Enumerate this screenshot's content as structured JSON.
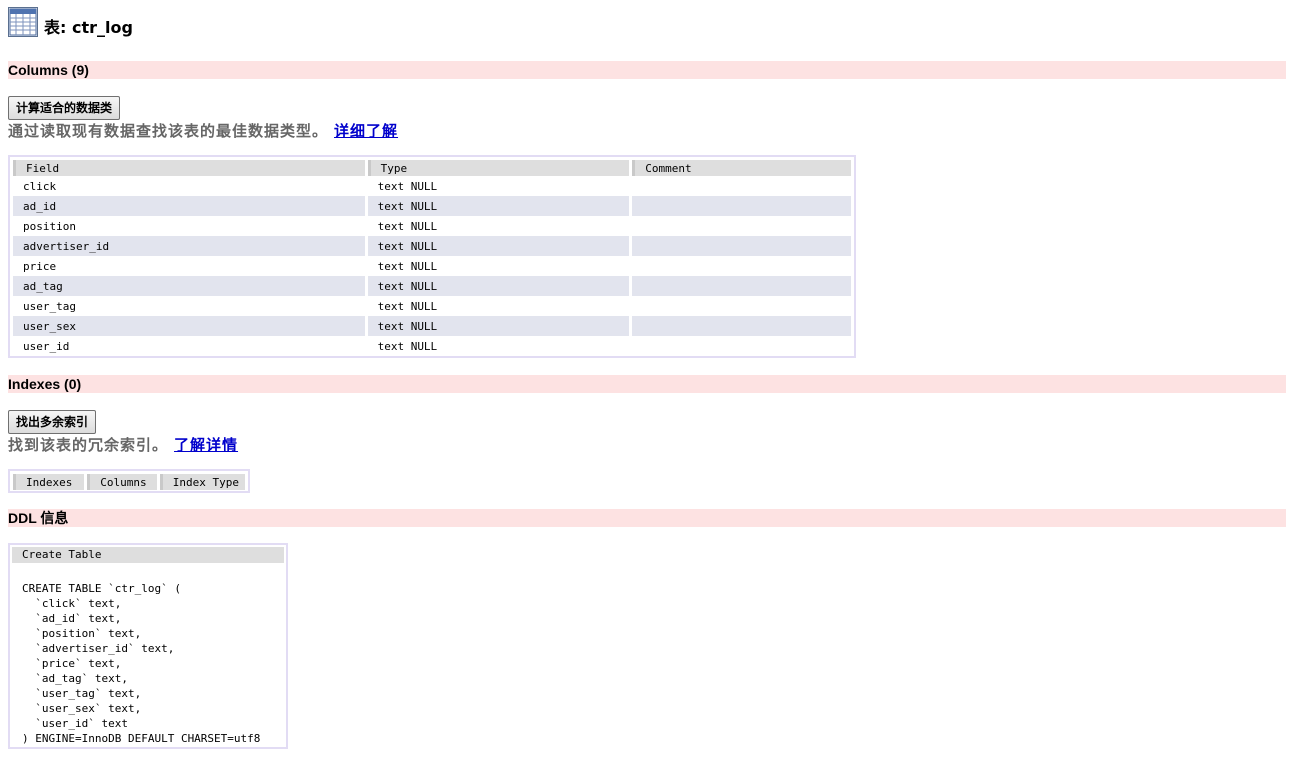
{
  "header": {
    "title": "表: ctr_log"
  },
  "columns_section": {
    "title": "Columns (9)",
    "button_label": "计算适合的数据类",
    "hint_text": "通过读取现有数据查找该表的最佳数据类型。",
    "hint_link": "详细了解",
    "headers": [
      "Field",
      "Type",
      "Comment"
    ],
    "rows": [
      {
        "field": "click",
        "type": "text NULL",
        "comment": ""
      },
      {
        "field": "ad_id",
        "type": "text NULL",
        "comment": ""
      },
      {
        "field": "position",
        "type": "text NULL",
        "comment": ""
      },
      {
        "field": "advertiser_id",
        "type": "text NULL",
        "comment": ""
      },
      {
        "field": "price",
        "type": "text NULL",
        "comment": ""
      },
      {
        "field": "ad_tag",
        "type": "text NULL",
        "comment": ""
      },
      {
        "field": "user_tag",
        "type": "text NULL",
        "comment": ""
      },
      {
        "field": "user_sex",
        "type": "text NULL",
        "comment": ""
      },
      {
        "field": "user_id",
        "type": "text NULL",
        "comment": ""
      }
    ]
  },
  "indexes_section": {
    "title": "Indexes (0)",
    "button_label": "找出多余索引",
    "hint_text": "找到该表的冗余索引。",
    "hint_link": "了解详情",
    "headers": [
      "Indexes",
      "Columns",
      "Index Type"
    ]
  },
  "ddl_section": {
    "title": "DDL 信息",
    "header": "Create Table",
    "code": "CREATE TABLE `ctr_log` (\n  `click` text,\n  `ad_id` text,\n  `position` text,\n  `advertiser_id` text,\n  `price` text,\n  `ad_tag` text,\n  `user_tag` text,\n  `user_sex` text,\n  `user_id` text\n) ENGINE=InnoDB DEFAULT CHARSET=utf8"
  }
}
